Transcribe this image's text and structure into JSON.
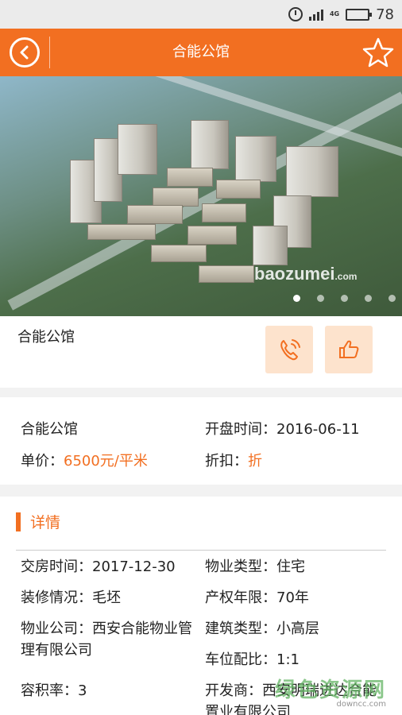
{
  "status_bar": {
    "battery_level": "78",
    "network": "4G"
  },
  "header": {
    "title": "合能公馆",
    "back_icon": "back-circle-icon",
    "favorite_icon": "star-icon"
  },
  "hero": {
    "watermark": "baozumei",
    "watermark_suffix": ".com",
    "dot_count": 5,
    "active_dot": 0
  },
  "summary": {
    "name": "合能公馆",
    "call_icon": "phone-icon",
    "like_icon": "thumbs-up-icon"
  },
  "info": {
    "name": "合能公馆",
    "open_label": "开盘时间：",
    "open_value": "2016-06-11",
    "price_label": "单价：",
    "price_value": "6500元/平米",
    "discount_label": "折扣：",
    "discount_value": "折"
  },
  "details": {
    "section_title": "详情",
    "handover_label": "交房时间：",
    "handover_value": "2017-12-30",
    "property_type_label": "物业类型：",
    "property_type_value": "住宅",
    "decoration_label": "装修情况：",
    "decoration_value": "毛坯",
    "tenure_label": "产权年限：",
    "tenure_value": "70年",
    "management_label": "物业公司：",
    "management_value": "西安合能物业管理有限公司",
    "building_type_label": "建筑类型：",
    "building_type_value": "小高层",
    "parking_label": "车位配比：",
    "parking_value": "1:1",
    "far_label": "容积率：",
    "far_value": "3",
    "developer_label": "开发商：",
    "developer_value": "西安明瑞进达合能置业有限公司"
  },
  "site_watermark": {
    "text": "绿色资源网",
    "url": "downcc.com"
  },
  "colors": {
    "accent": "#f26f21",
    "button_bg": "#fde3cd"
  }
}
